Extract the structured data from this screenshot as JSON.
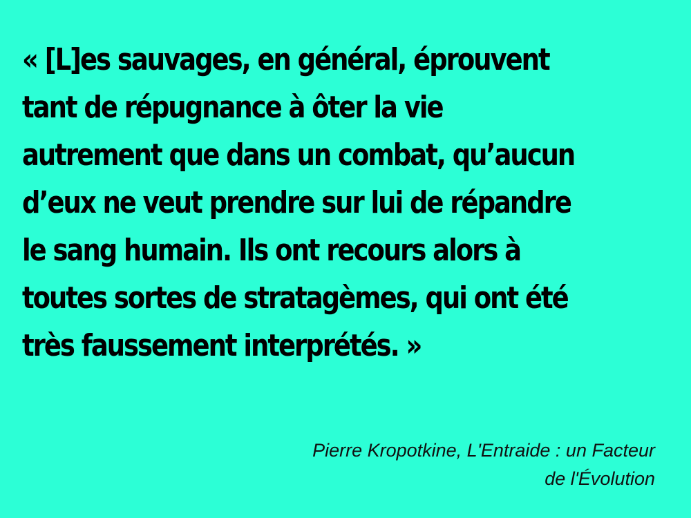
{
  "slide": {
    "background_color": "#2cffd6",
    "text_color": "#000000",
    "quote_lines": [
      "« [L]es sauvages, en général, éprouvent",
      "tant de répugnance à ôter la vie",
      "autrement que dans un combat, qu’aucun",
      "d’eux ne veut prendre sur lui de répandre",
      "le sang humain. Ils ont recours alors à",
      "toutes sortes de stratagèmes, qui ont été",
      "très faussement interprétés. »"
    ],
    "attribution_lines": [
      "Pierre Kropotkine, L'Entraide : un Facteur",
      "de l'Évolution"
    ]
  }
}
